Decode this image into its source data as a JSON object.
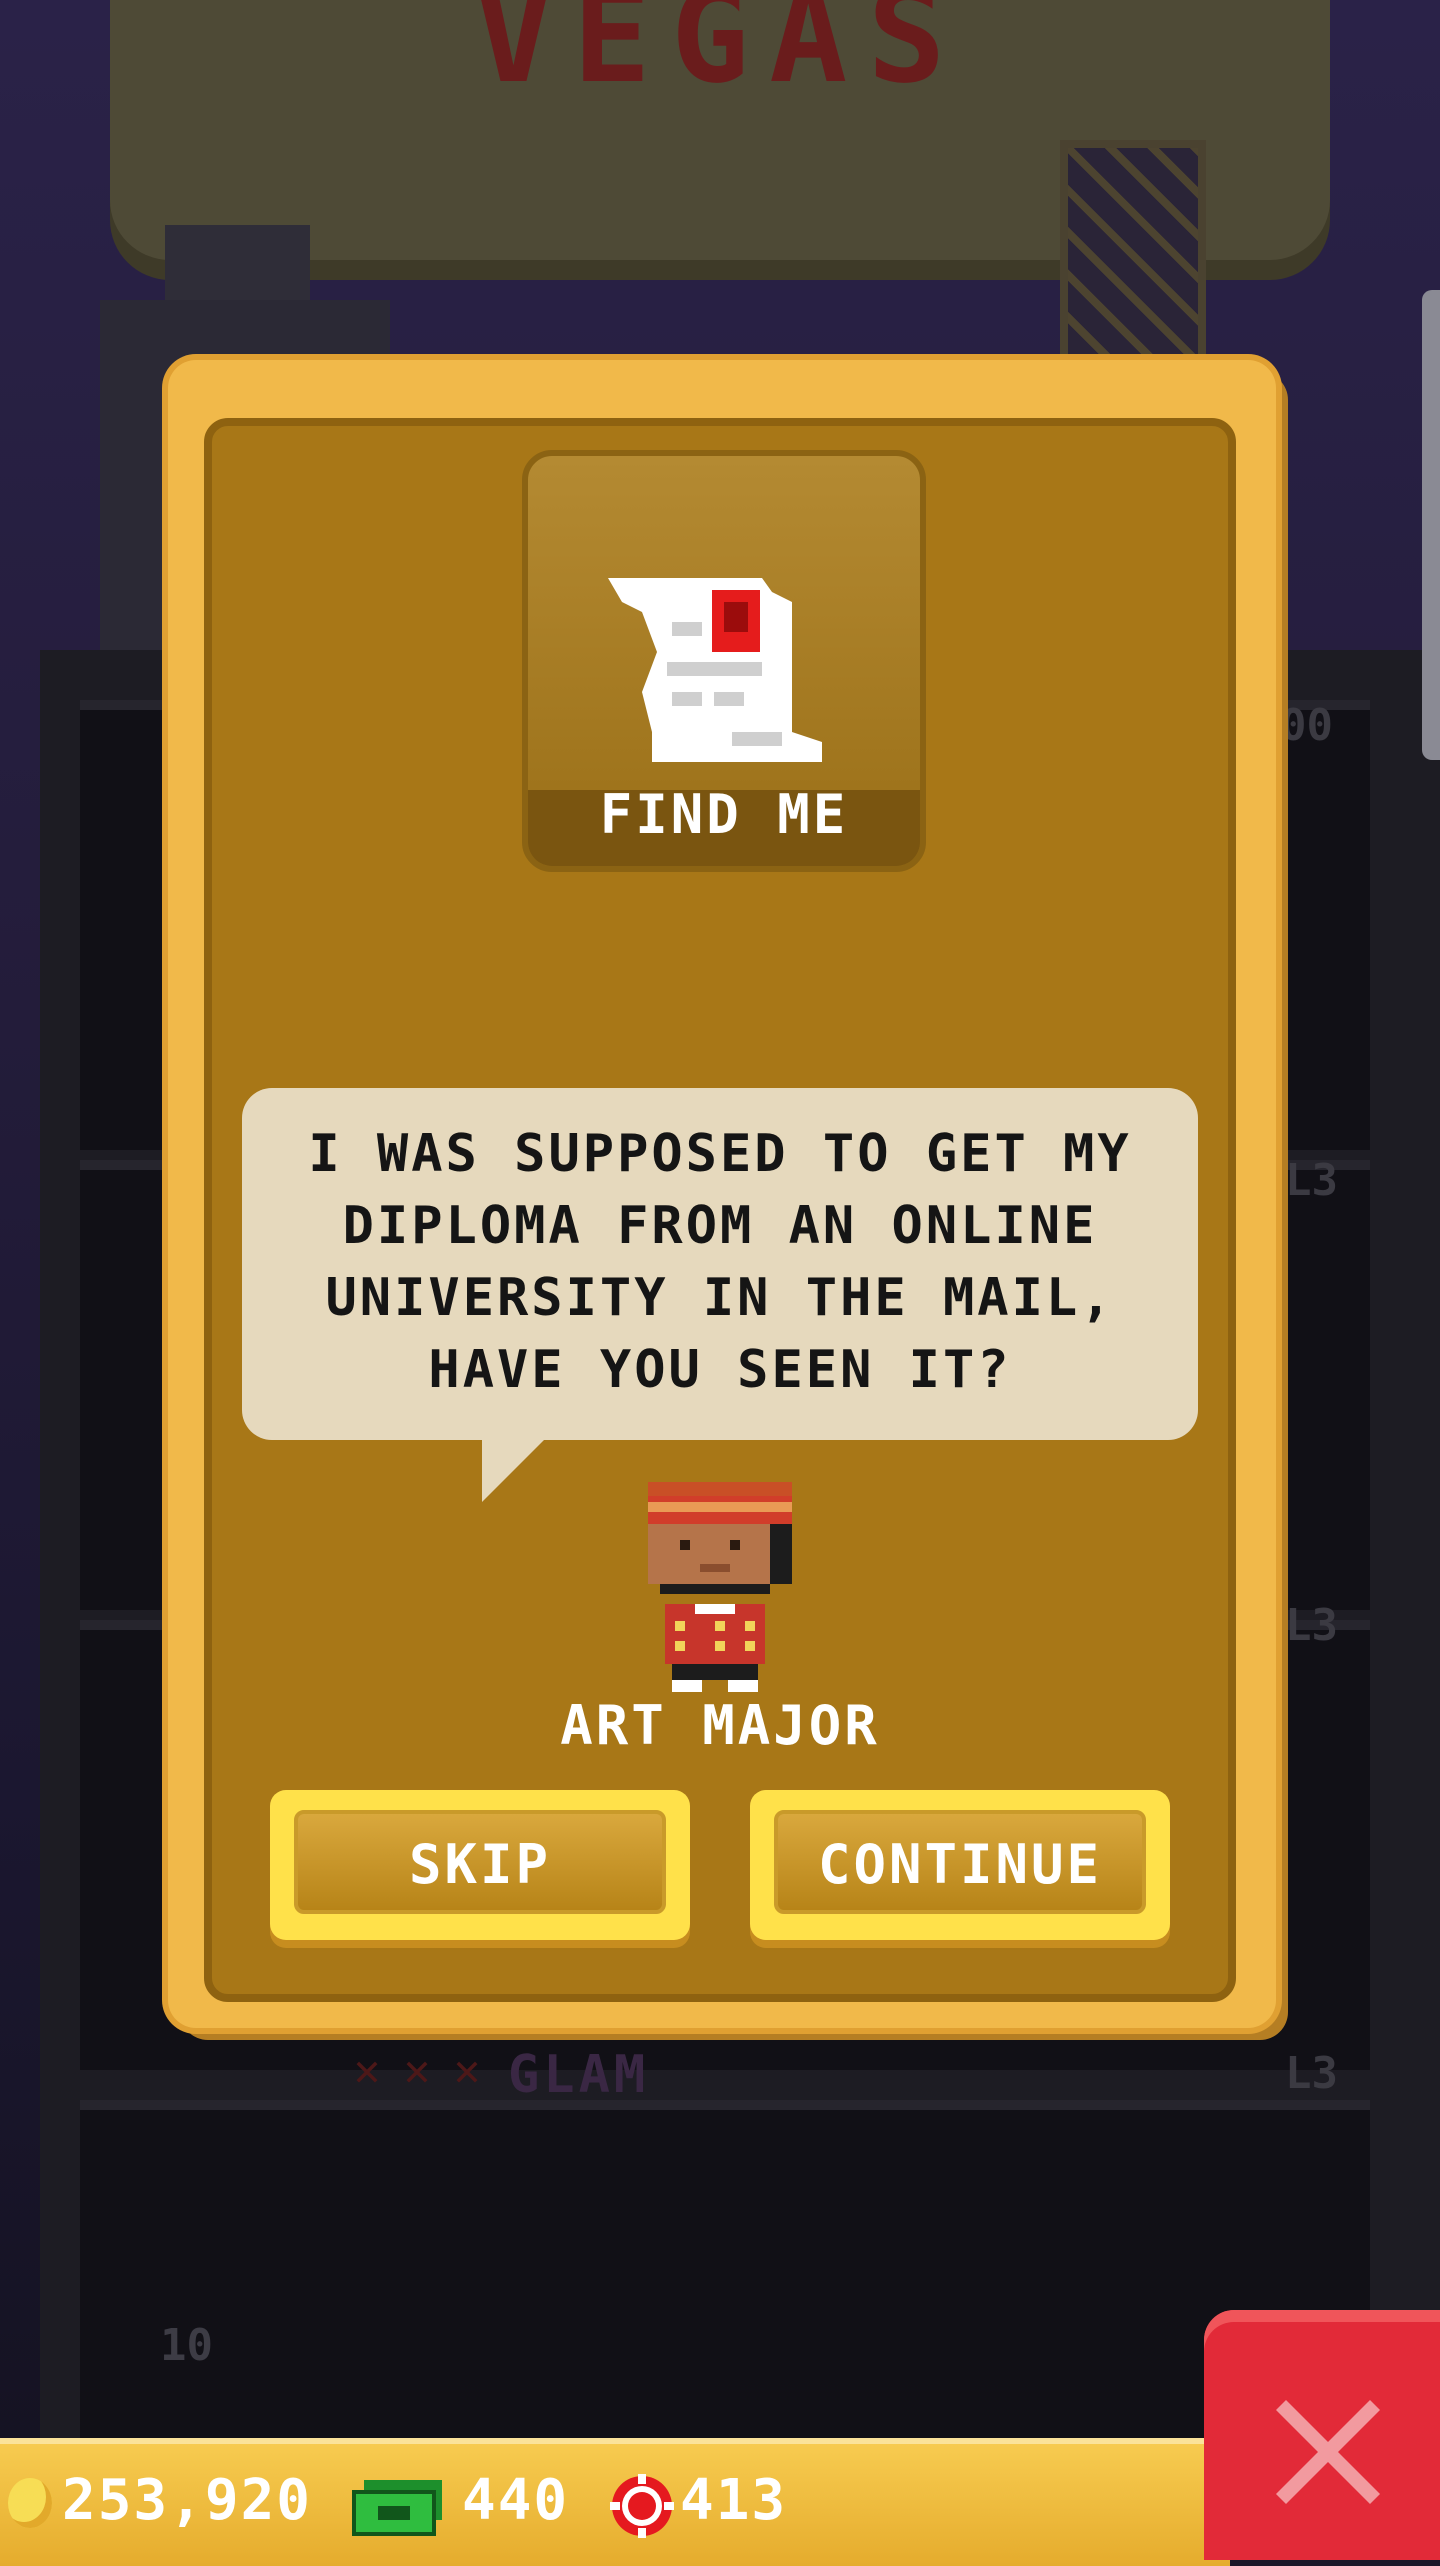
{
  "background": {
    "sign_text": "VEGAS",
    "floor_labels": [
      "00",
      "L3",
      "L3",
      "L3"
    ],
    "glam_label": "GLAM",
    "floor_number": "10"
  },
  "dialog": {
    "mission_title": "FIND ME",
    "mission_icon": "scroll-icon",
    "speech": "I WAS SUPPOSED TO GET MY DIPLOMA FROM AN ONLINE UNIVERSITY IN THE MAIL, HAVE YOU SEEN IT?",
    "character_name": "ART MAJOR",
    "skip_label": "SKIP",
    "continue_label": "CONTINUE"
  },
  "status_bar": {
    "coins": "253,920",
    "bux": "440",
    "chips": "413"
  },
  "colors": {
    "dialog_border": "#f1b94a",
    "dialog_bg": "#a87717",
    "speech_bg": "#e6d9bd",
    "button": "#ffe14a",
    "close_button": "#e22a38"
  }
}
